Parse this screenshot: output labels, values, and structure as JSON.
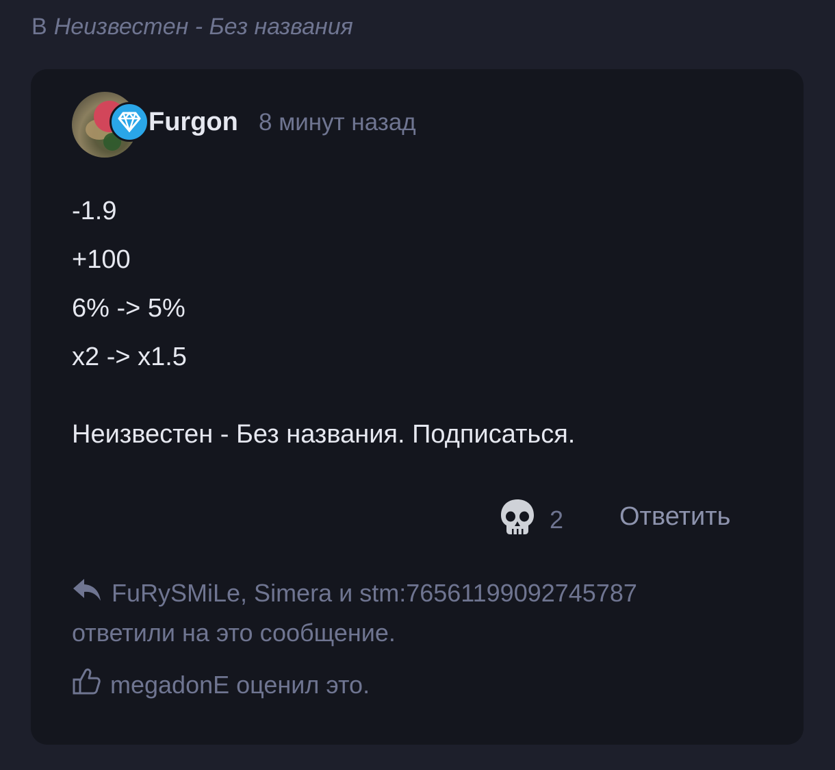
{
  "breadcrumb": {
    "prefix": "В",
    "topic": "Неизвестен - Без названия"
  },
  "post": {
    "username": "Furgon",
    "time": "8 минут назад",
    "lines": [
      "-1.9",
      "+100",
      "6% -> 5%",
      "x2 -> x1.5"
    ],
    "signature": "Неизвестен - Без названия. Подписаться.",
    "reaction_icon": "skull-icon",
    "reaction_count": "2",
    "reply_label": "Ответить",
    "replies_text_1": "FuRySMiLe, Simera и stm:76561199092745787",
    "replies_text_2": "ответили на это сообщение.",
    "likes_text": "megadonE оценил это."
  },
  "colors": {
    "background": "#1d1f2b",
    "card": "#14161e",
    "muted": "#6f7591",
    "text": "#e6e8f0",
    "badge_blue": "#2aa6e8",
    "badge_red": "#d2465a"
  }
}
